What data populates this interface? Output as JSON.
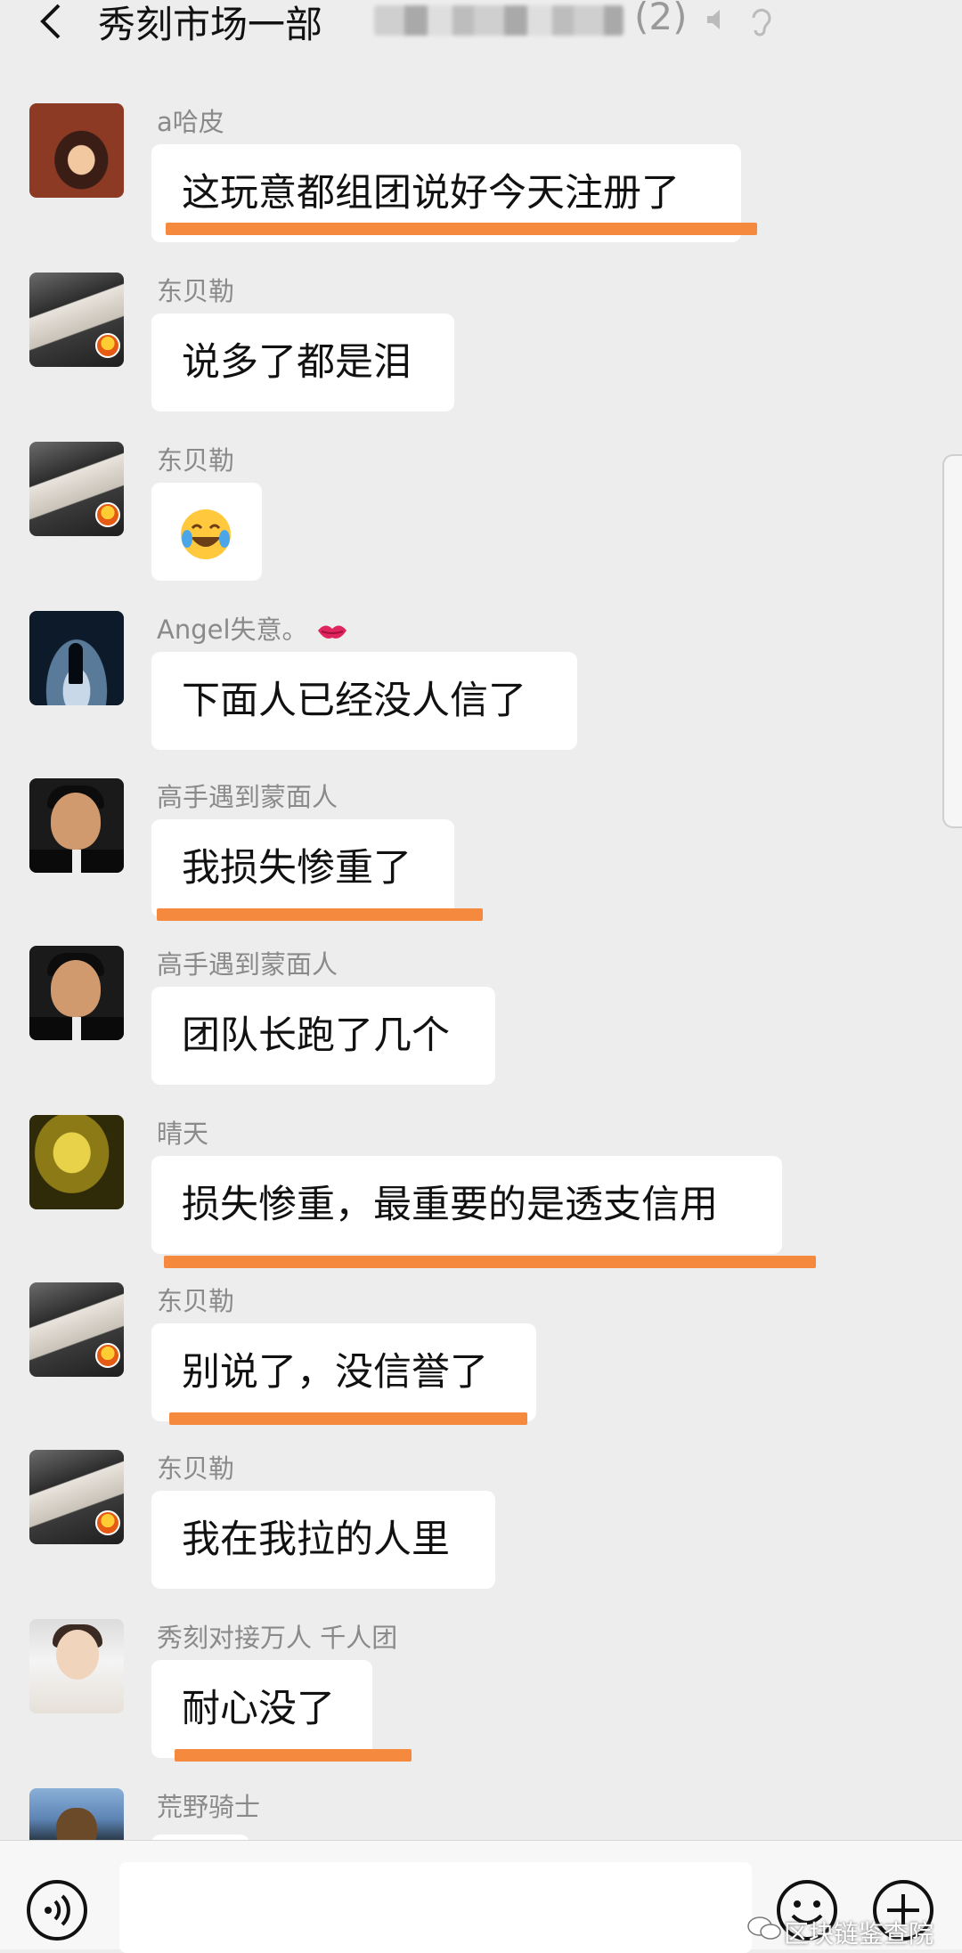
{
  "header": {
    "title": "秀刻市场一部",
    "title_count": "(2)"
  },
  "messages": [
    {
      "sender": "a哈皮",
      "text": "这玩意都组团说好今天注册了"
    },
    {
      "sender": "东贝勒",
      "text": "说多了都是泪"
    },
    {
      "sender": "东贝勒",
      "text": "",
      "emoji": "tears-of-joy-emoji"
    },
    {
      "sender": "Angel失意。",
      "text": "下面人已经没人信了",
      "sender_emoji": "kiss-mark-emoji"
    },
    {
      "sender": "高手遇到蒙面人",
      "text": "我损失惨重了"
    },
    {
      "sender": "高手遇到蒙面人",
      "text": "团队长跑了几个"
    },
    {
      "sender": "晴天",
      "text": "损失惨重，最重要的是透支信用"
    },
    {
      "sender": "东贝勒",
      "text": "别说了，没信誉了"
    },
    {
      "sender": "东贝勒",
      "text": "我在我拉的人里"
    },
    {
      "sender": "秀刻对接万人  千人团",
      "text": "耐心没了"
    },
    {
      "sender": "荒野骑士",
      "text": ""
    }
  ],
  "bottom_bar": {
    "input_value": ""
  },
  "watermark": "区块链鉴查院",
  "colors": {
    "background": "#ededed",
    "bubble": "#ffffff",
    "highlight_underline": "#f58a3e",
    "sender_name": "#8a8a8a"
  }
}
